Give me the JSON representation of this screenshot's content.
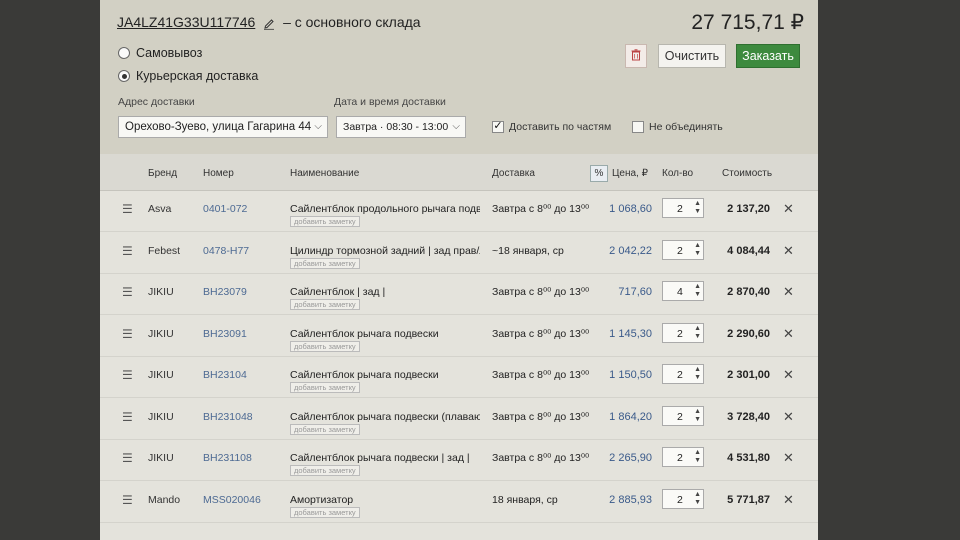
{
  "order": {
    "id": "JA4LZ41G33U117746",
    "source": "– с основного склада",
    "total": "27 715,71 ₽"
  },
  "delivery": {
    "options": [
      "Самовывоз",
      "Курьерская доставка"
    ],
    "selected": "Курьерская доставка",
    "address_label": "Адрес доставки",
    "address_value": "Орехово-Зуево, улица Гагарина 44",
    "datetime_label": "Дата и время доставки",
    "datetime_value": "Завтра · 08:30 - 13:00",
    "partial_label": "Доставить по частям",
    "partial_checked": true,
    "nocombine_label": "Не объединять",
    "nocombine_checked": false
  },
  "actions": {
    "clear": "Очистить",
    "order": "Заказать",
    "trash_icon": "trash-icon"
  },
  "table": {
    "headers": {
      "brand": "Бренд",
      "number": "Номер",
      "name": "Наименование",
      "delivery": "Доставка",
      "percent": "%",
      "price": "Цена, ₽",
      "qty": "Кол-во",
      "cost": "Стоимость"
    },
    "note_label": "добавить заметку",
    "rows": [
      {
        "brand": "Asva",
        "number": "0401-072",
        "name": "Сайлентблок продольного рычага подвеск",
        "delivery": "Завтра с 8⁰⁰ до 13⁰⁰",
        "price": "1 068,60",
        "qty": "2",
        "cost": "2 137,20"
      },
      {
        "brand": "Febest",
        "number": "0478-H77",
        "name": "Цилиндр тормозной задний | зад прав/лев |",
        "delivery": "~18 января, ср",
        "price": "2 042,22",
        "qty": "2",
        "cost": "4 084,44"
      },
      {
        "brand": "JIKIU",
        "number": "BH23079",
        "name": "Сайлентблок | зад |",
        "delivery": "Завтра с 8⁰⁰ до 13⁰⁰",
        "price": "717,60",
        "qty": "4",
        "cost": "2 870,40"
      },
      {
        "brand": "JIKIU",
        "number": "BH23091",
        "name": "Сайлентблок рычага подвески",
        "delivery": "Завтра с 8⁰⁰ до 13⁰⁰",
        "price": "1 145,30",
        "qty": "2",
        "cost": "2 290,60"
      },
      {
        "brand": "JIKIU",
        "number": "BH23104",
        "name": "Сайлентблок рычага подвески",
        "delivery": "Завтра с 8⁰⁰ до 13⁰⁰",
        "price": "1 150,50",
        "qty": "2",
        "cost": "2 301,00"
      },
      {
        "brand": "JIKIU",
        "number": "BH231048",
        "name": "Сайлентблок рычага подвески (плавающий)",
        "delivery": "Завтра с 8⁰⁰ до 13⁰⁰",
        "price": "1 864,20",
        "qty": "2",
        "cost": "3 728,40"
      },
      {
        "brand": "JIKIU",
        "number": "BH231108",
        "name": "Сайлентблок рычага подвески | зад |",
        "delivery": "Завтра с 8⁰⁰ до 13⁰⁰",
        "price": "2 265,90",
        "qty": "2",
        "cost": "4 531,80"
      },
      {
        "brand": "Mando",
        "number": "MSS020046",
        "name": "Амортизатор",
        "delivery": "18 января, ср",
        "price": "2 885,93",
        "qty": "2",
        "cost": "5 771,87"
      }
    ]
  }
}
